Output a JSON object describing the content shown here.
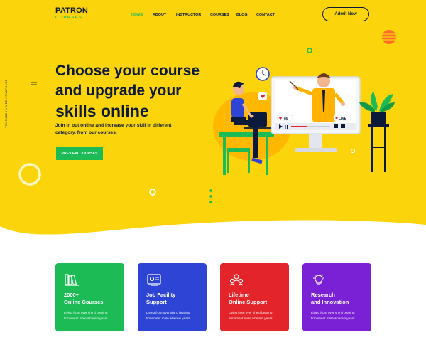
{
  "brand": {
    "name": "PATRON",
    "sub": "COURSES"
  },
  "nav": [
    "HOME",
    "ABOUT",
    "INSTRUCTOR",
    "COURSES",
    "BLOG",
    "CONTACT"
  ],
  "header": {
    "cta": "Admit Now"
  },
  "social": "YOUTUBE / VIMEO / SNAPCHAT",
  "hero": {
    "title_line1": "Choose your course",
    "title_line2": "and upgrade your",
    "title_line3": "skills online",
    "description": "Join in out online and increase your skill in different category, from our courses.",
    "cta": "PREVIEW COURSES",
    "video_count": "80",
    "live_label": "LIVE"
  },
  "features": [
    {
      "icon": "books-icon",
      "title": "2000+\nOnline Courses",
      "text": "Living from over she'd bearing\nfirmament male wherein years."
    },
    {
      "icon": "job-icon",
      "title": "Job Facility\nSupport",
      "text": "Living from over she'd bearing\nfirmament male wherein years."
    },
    {
      "icon": "support-icon",
      "title": "Lifetime\nOnline Support",
      "text": "Living from over she'd bearing\nfirmament male wherein years."
    },
    {
      "icon": "lightbulb-icon",
      "title": "Research\nand Innovation",
      "text": "Living from over she'd bearing\nfirmament male wherein years."
    }
  ],
  "colors": {
    "hero_bg": "#fbd40b",
    "primary": "#1cbb55",
    "navy": "#0b1a3a",
    "card_blue": "#2e44d4",
    "card_red": "#e3242b",
    "card_purple": "#7a21d6"
  }
}
